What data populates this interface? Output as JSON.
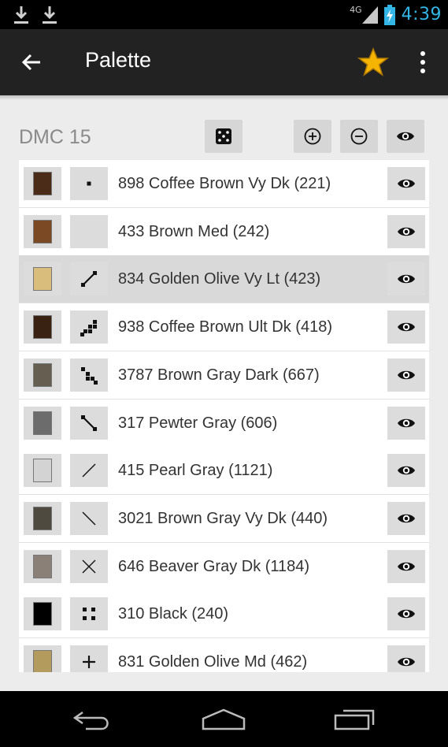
{
  "status_bar": {
    "network": "4G",
    "time": "4:39",
    "icons": [
      "download-icon",
      "download-icon",
      "signal-icon",
      "battery-charging-icon"
    ]
  },
  "action_bar": {
    "title": "Palette",
    "icons": [
      "back-arrow-icon",
      "star-icon",
      "more-vert-icon"
    ],
    "star_color": "#f5b400"
  },
  "palette": {
    "name": "DMC 15",
    "header_buttons": [
      "dice-icon",
      "zoom-in-icon",
      "zoom-out-icon",
      "eye-icon"
    ]
  },
  "items": [
    {
      "label": "898 Coffee Brown Vy Dk (221)",
      "color": "#4a2c18",
      "symbol": "dot",
      "selected": false
    },
    {
      "label": "433 Brown Med (242)",
      "color": "#7b4a24",
      "symbol": "none",
      "selected": false
    },
    {
      "label": "834 Golden Olive Vy Lt (423)",
      "color": "#d9bd7c",
      "symbol": "diag-dots-arrow",
      "selected": true
    },
    {
      "label": "938 Coffee Brown Ult Dk (418)",
      "color": "#3a2212",
      "symbol": "stair",
      "selected": false
    },
    {
      "label": "3787 Brown Gray Dark (667)",
      "color": "#675e52",
      "symbol": "stair-down",
      "selected": false
    },
    {
      "label": "317 Pewter Gray (606)",
      "color": "#6c6c6c",
      "symbol": "diag-down-arrow",
      "selected": false
    },
    {
      "label": "415 Pearl Gray (1121)",
      "color": "#d3d3d3",
      "symbol": "slash",
      "selected": false
    },
    {
      "label": "3021 Brown Gray Vy Dk (440)",
      "color": "#4f4a40",
      "symbol": "backslash",
      "selected": false
    },
    {
      "label": "646 Beaver Gray Dk (1184)",
      "color": "#8a8078",
      "symbol": "cross",
      "selected": false
    },
    {
      "label": "310 Black (240)",
      "color": "#000000",
      "symbol": "four-dots",
      "selected": false
    },
    {
      "label": "831 Golden Olive Md (462)",
      "color": "#b39b5e",
      "symbol": "plus",
      "selected": false
    }
  ],
  "nav_bar": {
    "icons": [
      "back-icon",
      "home-icon",
      "recents-icon"
    ]
  }
}
